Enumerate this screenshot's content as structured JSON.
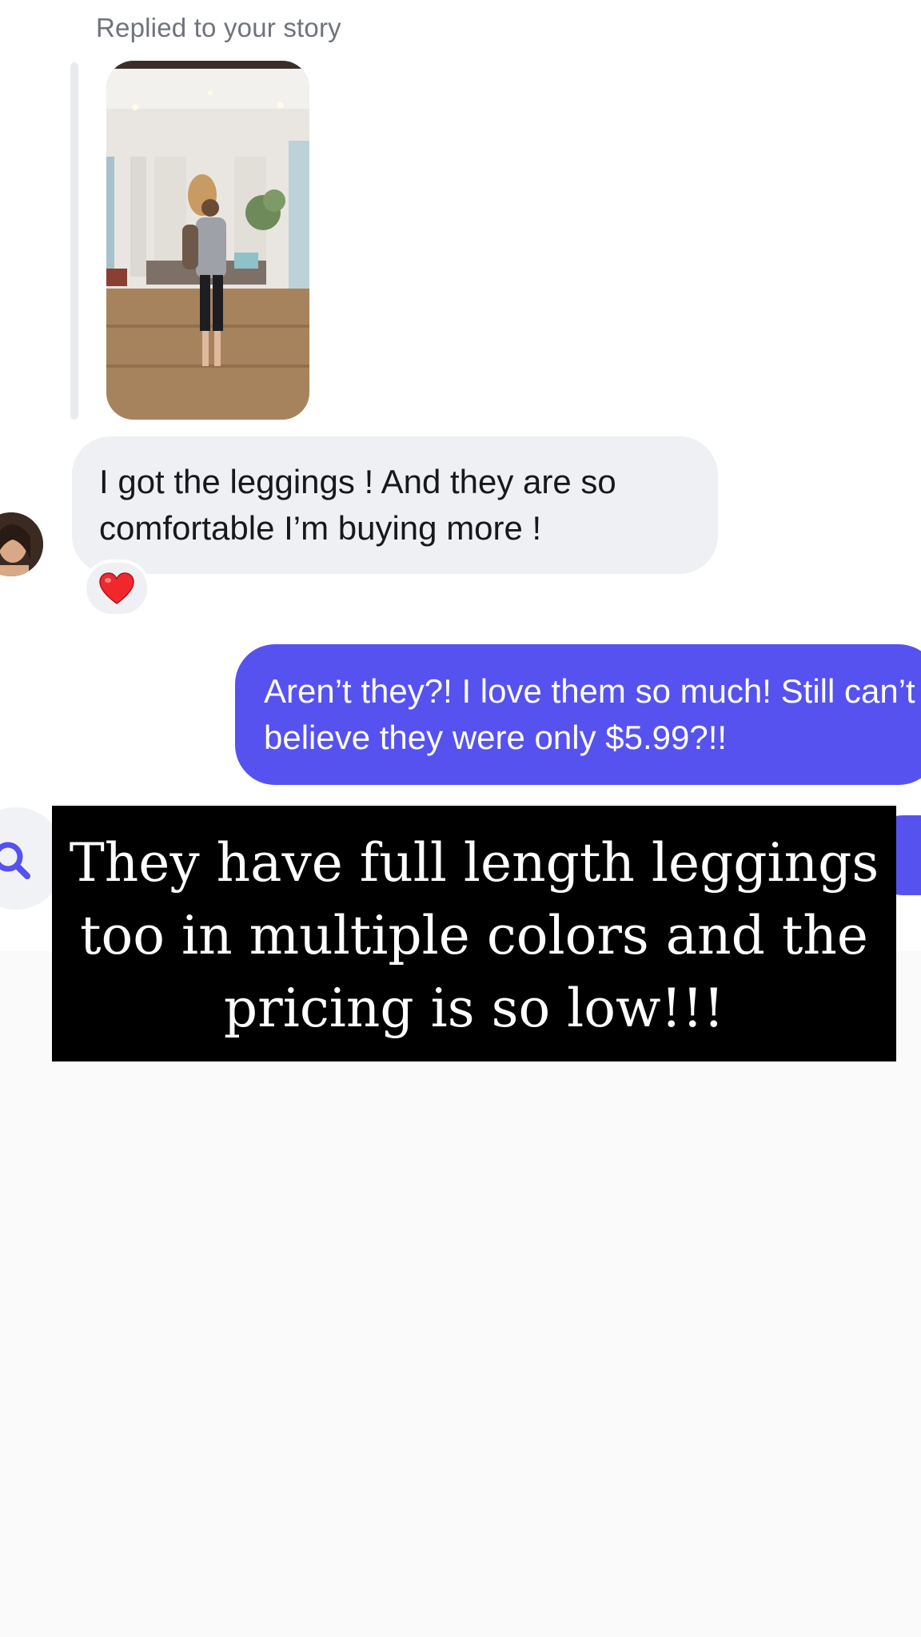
{
  "story_reply": {
    "label": "Replied to your story",
    "thumbnail_icon": "story-photo"
  },
  "messages": [
    {
      "direction": "incoming",
      "text": "I got the leggings ! And they are so comfortable I’m buying more !",
      "reaction": "❤️"
    },
    {
      "direction": "outgoing",
      "text": "Aren’t they?! I love them so much! Still can’t believe they were only $5.99?!!"
    }
  ],
  "caption": {
    "text": "They have full length leggings too in multiple colors and the pricing is so low!!!"
  },
  "colors": {
    "incoming_bubble": "#eef0f3",
    "outgoing_bubble": "#5652f0",
    "caption_background": "#000000",
    "accent": "#5652f0"
  },
  "icons": {
    "avatar": "avatar-photo",
    "search": "search-icon",
    "reaction": "heart-icon"
  }
}
